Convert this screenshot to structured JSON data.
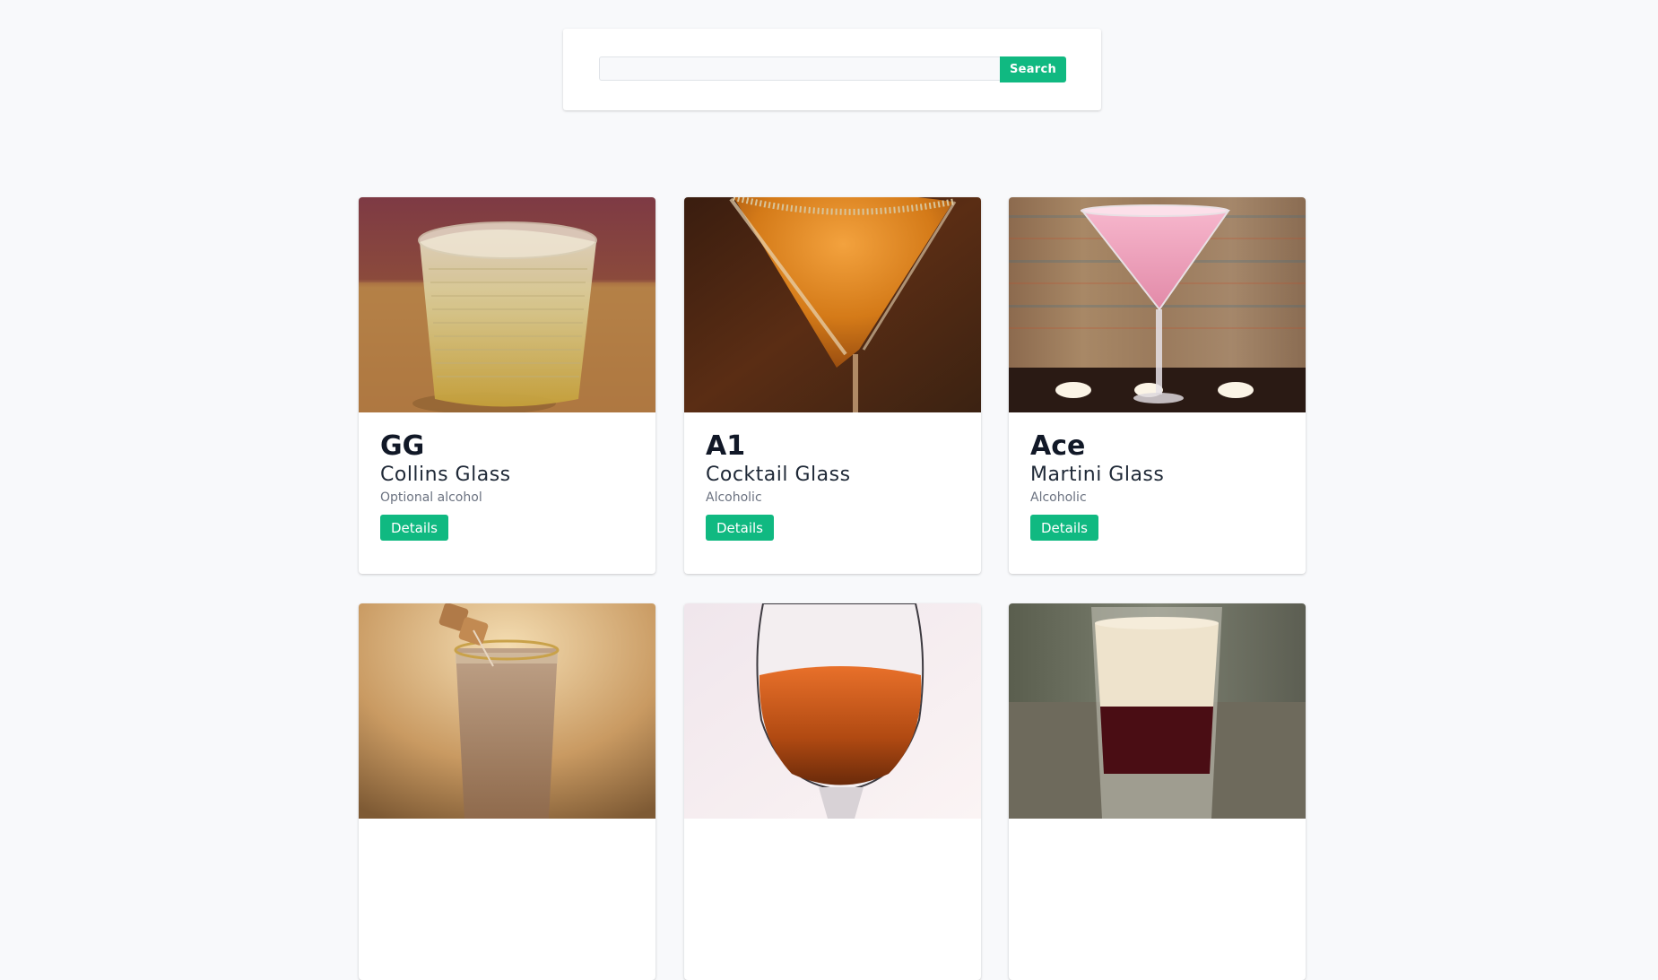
{
  "search": {
    "value": "",
    "placeholder": "",
    "button_label": "Search"
  },
  "drinks": [
    {
      "name": "GG",
      "glass": "Collins Glass",
      "alcoholic": "Optional alcohol",
      "details_label": "Details",
      "image": "whiskey-tumbler-drink-image"
    },
    {
      "name": "A1",
      "glass": "Cocktail Glass",
      "alcoholic": "Alcoholic",
      "details_label": "Details",
      "image": "orange-cocktail-sugared-rim-image"
    },
    {
      "name": "Ace",
      "glass": "Martini Glass",
      "alcoholic": "Alcoholic",
      "details_label": "Details",
      "image": "pink-martini-candles-image"
    },
    {
      "name": "",
      "glass": "",
      "alcoholic": "",
      "details_label": "",
      "image": "creamy-shot-caramel-image"
    },
    {
      "name": "",
      "glass": "",
      "alcoholic": "",
      "details_label": "",
      "image": "amber-wine-glass-image"
    },
    {
      "name": "",
      "glass": "",
      "alcoholic": "",
      "details_label": "",
      "image": "layered-red-cream-shot-image"
    }
  ],
  "colors": {
    "accent": "#10b981",
    "background": "#f8f9fb",
    "heading": "#111827",
    "muted": "#6b7280"
  }
}
